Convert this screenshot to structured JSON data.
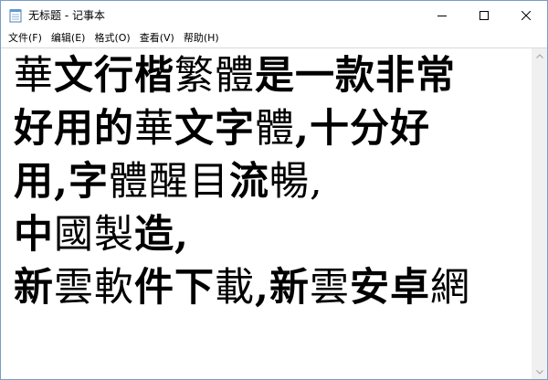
{
  "window": {
    "title": "无标题 - 记事本",
    "icon": "notepad-icon"
  },
  "caption_buttons": [
    "minimize-icon",
    "maximize-icon",
    "close-icon"
  ],
  "menu": {
    "items": [
      "文件(F)",
      "编辑(E)",
      "格式(O)",
      "查看(V)",
      "帮助(H)"
    ]
  },
  "document": {
    "lines": [
      [
        {
          "t": "華",
          "b": false
        },
        {
          "t": "文行楷",
          "b": true
        },
        {
          "t": "繁體",
          "b": false
        },
        {
          "t": "是一款非常",
          "b": true
        }
      ],
      [
        {
          "t": "好用的",
          "b": true
        },
        {
          "t": "華",
          "b": false
        },
        {
          "t": "文字",
          "b": true
        },
        {
          "t": "體",
          "b": false
        },
        {
          "t": ",十分好",
          "b": true
        }
      ],
      [
        {
          "t": "用,字",
          "b": true
        },
        {
          "t": "體醒目",
          "b": false
        },
        {
          "t": "流",
          "b": true
        },
        {
          "t": "暢,",
          "b": false
        }
      ],
      [
        {
          "t": "中",
          "b": true
        },
        {
          "t": "國製",
          "b": false
        },
        {
          "t": "造,",
          "b": true
        }
      ],
      [
        {
          "t": "新",
          "b": true
        },
        {
          "t": "雲軟",
          "b": false
        },
        {
          "t": "件下",
          "b": true
        },
        {
          "t": "載",
          "b": false
        },
        {
          "t": ",新",
          "b": true
        },
        {
          "t": "雲",
          "b": false
        },
        {
          "t": "安卓",
          "b": true
        },
        {
          "t": "網",
          "b": false
        }
      ]
    ]
  },
  "colors": {
    "window_border": "#7a9cc6",
    "text": "#000000",
    "scrollbar_track": "#f0f0f0"
  }
}
